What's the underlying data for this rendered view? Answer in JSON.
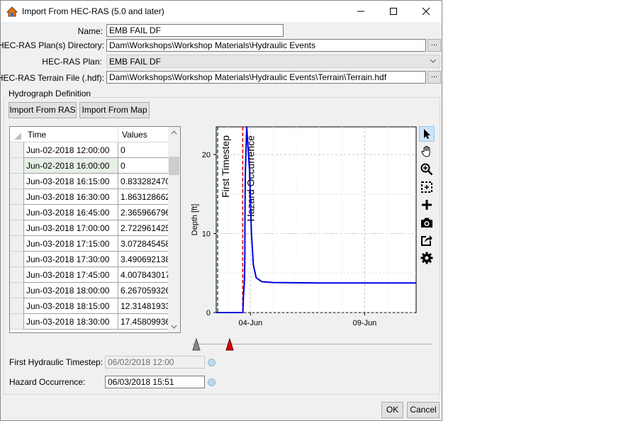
{
  "window": {
    "title": "Import From HEC-RAS (5.0 and later)"
  },
  "form": {
    "name_label": "Name:",
    "name_value": "EMB FAIL DF",
    "plan_dir_label": "HEC-RAS Plan(s) Directory:",
    "plan_dir_value": "Dam\\Workshops\\Workshop Materials\\Hydraulic Events",
    "plan_label": "HEC-RAS Plan:",
    "plan_value": "EMB FAIL DF",
    "terrain_label": "HEC-RAS Terrain File (.hdf):",
    "terrain_value": "Dam\\Workshops\\Workshop Materials\\Hydraulic Events\\Terrain\\Terrain.hdf",
    "browse": "..."
  },
  "hydrograph": {
    "group_title": "Hydrograph Definition",
    "import_ras": "Import From RAS",
    "import_map": "Import From Map",
    "columns": [
      "Time",
      "Values"
    ],
    "rows": [
      {
        "time": "Jun-02-2018 12:00:00",
        "value": "0"
      },
      {
        "time": "Jun-02-2018 16:00:00",
        "value": "0"
      },
      {
        "time": "Jun-03-2018 16:15:00",
        "value": "0.833282470"
      },
      {
        "time": "Jun-03-2018 16:30:00",
        "value": "1.863128662"
      },
      {
        "time": "Jun-03-2018 16:45:00",
        "value": "2.365966796"
      },
      {
        "time": "Jun-03-2018 17:00:00",
        "value": "2.722961425"
      },
      {
        "time": "Jun-03-2018 17:15:00",
        "value": "3.072845458"
      },
      {
        "time": "Jun-03-2018 17:30:00",
        "value": "3.490692138"
      },
      {
        "time": "Jun-03-2018 17:45:00",
        "value": "4.007843017"
      },
      {
        "time": "Jun-03-2018 18:00:00",
        "value": "6.267059326"
      },
      {
        "time": "Jun-03-2018 18:15:00",
        "value": "12.31481933"
      },
      {
        "time": "Jun-03-2018 18:30:00",
        "value": "17.45809936"
      }
    ]
  },
  "chart_data": {
    "type": "line",
    "ylabel": "Depth [ft]",
    "xlabel": "",
    "x_ticks": [
      "04-Jun",
      "09-Jun"
    ],
    "y_ticks": [
      "0",
      "10",
      "20"
    ],
    "xlim_days_label": "Jun 2 2018 – Jun 11 2018",
    "ylim": [
      0,
      23.5
    ],
    "series": [
      {
        "color": "#0000dd",
        "x": [
          "Jun-02 12:00",
          "Jun-03 16:00",
          "Jun-03 16:15",
          "Jun-03 16:30",
          "Jun-03 17:00",
          "Jun-03 17:30",
          "Jun-03 18:00",
          "Jun-03 18:15",
          "Jun-03 18:30",
          "Jun-03 20:00",
          "Jun-03 23:00",
          "Jun-04 01:00",
          "Jun-04 03:00",
          "Jun-04 06:00",
          "Jun-04 12:00",
          "Jun-05 00:00",
          "Jun-07 00:00",
          "Jun-10 00:00",
          "Jun-11 06:00"
        ],
        "x_days": [
          0.5,
          1.667,
          1.677,
          1.688,
          1.708,
          1.729,
          1.75,
          1.76,
          1.771,
          1.833,
          1.958,
          2.042,
          2.125,
          2.25,
          2.5,
          3.0,
          5.0,
          8.0,
          9.25
        ],
        "y": [
          0,
          0,
          0.83,
          1.86,
          2.72,
          3.49,
          6.27,
          12.31,
          17.46,
          23.5,
          18,
          10,
          6,
          4.4,
          3.9,
          3.8,
          3.75,
          3.75,
          3.75
        ]
      }
    ],
    "markers": [
      {
        "label": "First Timestep",
        "x_days": 0.5,
        "color": "#1a7f1a",
        "style": "dashed"
      },
      {
        "label": "Hazard Occurrence",
        "x_days": 1.66,
        "color": "#dd0000",
        "style": "dashed"
      }
    ],
    "grid": true
  },
  "timing": {
    "first_label": "First Hydraulic Timestep:",
    "first_value": "06/02/2018 12:00",
    "hazard_label": "Hazard Occurrence:",
    "hazard_value": "06/03/2018 15:51"
  },
  "footer": {
    "ok": "OK",
    "cancel": "Cancel"
  },
  "colors": {
    "accent": "#0078d7",
    "hazard": "#dd0000",
    "first": "#1a7f1a",
    "series": "#0000dd"
  }
}
